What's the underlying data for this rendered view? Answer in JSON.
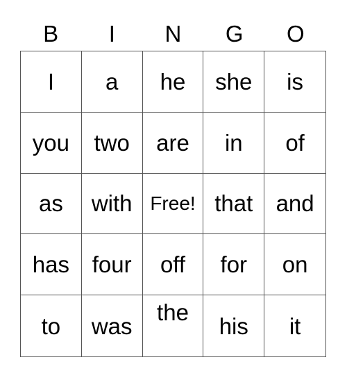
{
  "card": {
    "header": [
      "B",
      "I",
      "N",
      "G",
      "O"
    ],
    "rows": [
      [
        "I",
        "a",
        "he",
        "she",
        "is"
      ],
      [
        "you",
        "two",
        "are",
        "in",
        "of"
      ],
      [
        "as",
        "with",
        "Free!",
        "that",
        "and"
      ],
      [
        "has",
        "four",
        "off",
        "for",
        "on"
      ],
      [
        "to",
        "was",
        "the",
        "his",
        "it"
      ]
    ],
    "free_space": "Free!"
  }
}
